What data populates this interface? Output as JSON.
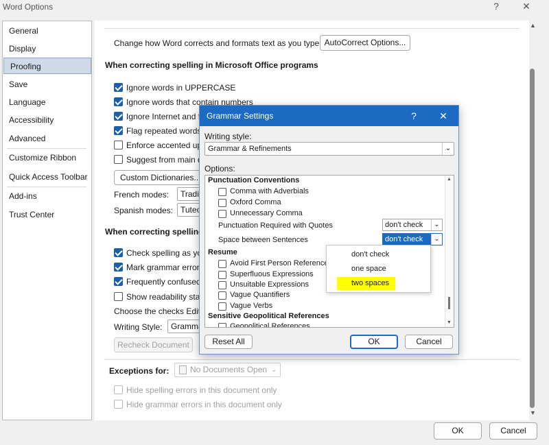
{
  "window": {
    "title": "Word Options",
    "help": "?",
    "close": "✕"
  },
  "nav": {
    "items": [
      "General",
      "Display",
      "Proofing",
      "Save",
      "Language",
      "Accessibility",
      "Advanced",
      "Customize Ribbon",
      "Quick Access Toolbar",
      "Add-ins",
      "Trust Center"
    ],
    "selected": "Proofing"
  },
  "content": {
    "autocorrect_prompt": "Change how Word corrects and formats text as you type:",
    "autocorrect_button": "AutoCorrect Options...",
    "section_office": "When correcting spelling in Microsoft Office programs",
    "office_options": [
      {
        "label": "Ignore words in UPPERCASE",
        "checked": true
      },
      {
        "label": "Ignore words that contain numbers",
        "checked": true
      },
      {
        "label": "Ignore Internet and fi",
        "checked": true
      },
      {
        "label": "Flag repeated words",
        "checked": true
      },
      {
        "label": "Enforce accented upp",
        "checked": false
      },
      {
        "label": "Suggest from main d",
        "checked": false
      }
    ],
    "custom_dict_button": "Custom Dictionaries...",
    "french_modes_label": "French modes:",
    "french_modes_value": "Traditi",
    "spanish_modes_label": "Spanish modes:",
    "spanish_modes_value": "Tuteo",
    "section_word": "When correcting spelling",
    "word_options": [
      {
        "label": "Check spelling as you",
        "checked": true
      },
      {
        "label": "Mark grammar errors",
        "checked": true
      },
      {
        "label": "Frequently confused",
        "checked": true
      },
      {
        "label": "Show readability stati",
        "checked": false
      }
    ],
    "choose_checks": "Choose the checks Edito",
    "writing_style_label": "Writing Style:",
    "writing_style_value": "Gramma",
    "recheck_button": "Recheck Document",
    "exceptions_label": "Exceptions for:",
    "exceptions_value": "No Documents Open",
    "hide_spelling": "Hide spelling errors in this document only",
    "hide_grammar": "Hide grammar errors in this document only"
  },
  "footer": {
    "ok": "OK",
    "cancel": "Cancel"
  },
  "dialog": {
    "title": "Grammar Settings",
    "help": "?",
    "close": "✕",
    "writing_style_label": "Writing style:",
    "writing_style_value": "Grammar & Refinements",
    "options_label": "Options:",
    "group_punctuation": "Punctuation Conventions",
    "punctuation_items": [
      "Comma with Adverbials",
      "Oxford Comma",
      "Unnecessary Comma"
    ],
    "quotes_label": "Punctuation Required with Quotes",
    "quotes_value": "don't check",
    "space_label": "Space between Sentences",
    "space_value": "don't check",
    "group_resume": "Resume",
    "resume_items": [
      "Avoid First Person Reference",
      "Superfluous Expressions",
      "Unsuitable Expressions",
      "Vague Quantifiers",
      "Vague Verbs"
    ],
    "group_geo": "Sensitive Geopolitical References",
    "geo_items": [
      "Geopolitical References"
    ],
    "reset_button": "Reset All",
    "ok_button": "OK",
    "cancel_button": "Cancel",
    "space_options": [
      "don't check",
      "one space",
      "two spaces"
    ],
    "highlight_color": "#ffff00"
  }
}
